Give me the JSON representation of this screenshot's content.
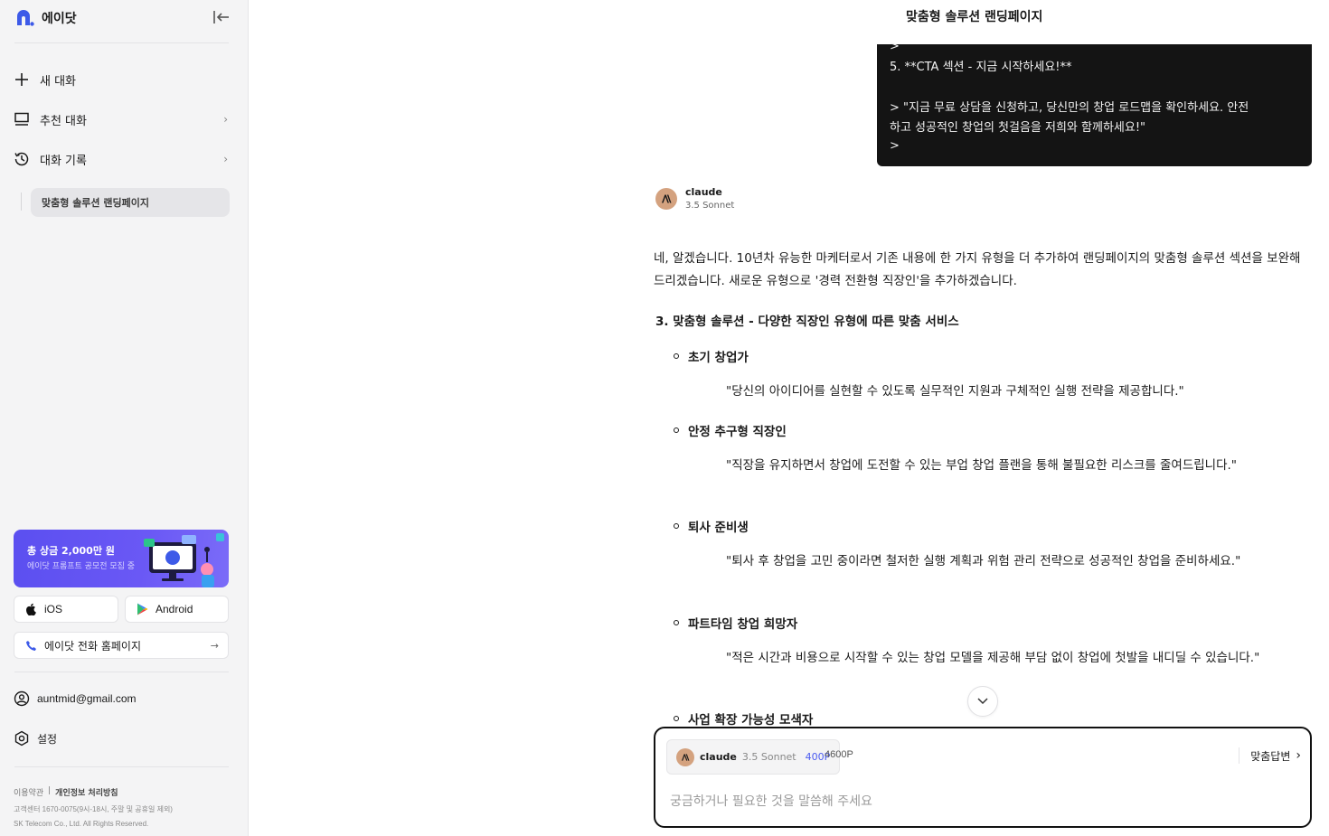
{
  "sidebar": {
    "brand": "에이닷",
    "nav": [
      {
        "label": "새 대화"
      },
      {
        "label": "추천 대화"
      },
      {
        "label": "대화 기록"
      }
    ],
    "history": [
      {
        "label": "맞춤형 솔루션 랜딩페이지"
      }
    ],
    "promo": {
      "title": "총 상금 2,000만 원",
      "subtitle": "에이닷 프롬프트 공모전 모집 중"
    },
    "apps": {
      "ios": "iOS",
      "android": "Android"
    },
    "phone_link": "에이닷 전화 홈페이지",
    "account_email": "auntmid@gmail.com",
    "settings": "설정",
    "footer": {
      "terms": "이용약관",
      "privacy": "개인정보 처리방침",
      "support": "고객센터 1670-0075(9시-18시, 주말 및 공휴일 제외)",
      "copyright": "SK Telecom Co., Ltd. All Rights Reserved."
    }
  },
  "main": {
    "title": "맞춤형 솔루션 랜딩페이지",
    "code_lines": [
      ">",
      "5. **CTA 섹션 - 지금 시작하세요!**",
      "",
      "> \"지금 무료 상담을 신청하고, 당신만의 창업 로드맵을 확인하세요. 안전",
      "하고 성공적인 창업의 첫걸음을 저희와 함께하세요!\"",
      ">"
    ],
    "model": {
      "name": "claude",
      "version": "3.5 Sonnet"
    },
    "intro": "네, 알겠습니다. 10년차 유능한 마케터로서 기존 내용에 한 가지 유형을 더 추가하여 랜딩페이지의 맞춤형 솔루션 섹션을 보완해 드리겠습니다. 새로운 유형으로 '경력 전환형 직장인'을 추가하겠습니다.",
    "section_heading": "3. 맞춤형 솔루션 - 다양한 직장인 유형에 따른 맞춤 서비스",
    "items": [
      {
        "title": "초기 창업가",
        "quote": "\"당신의 아이디어를 실현할 수 있도록 실무적인 지원과 구체적인 실행 전략을 제공합니다.\""
      },
      {
        "title": "안정 추구형 직장인",
        "quote": "\"직장을 유지하면서 창업에 도전할 수 있는 부업 창업 플랜을 통해 불필요한 리스크를 줄여드립니다.\""
      },
      {
        "title": "퇴사 준비생",
        "quote": "\"퇴사 후 창업을 고민 중이라면 철저한 실행 계획과 위험 관리 전략으로 성공적인 창업을 준비하세요.\""
      },
      {
        "title": "파트타임 창업 희망자",
        "quote": "\"적은 시간과 비용으로 시작할 수 있는 창업 모델을 제공해 부담 없이 창업에 첫발을 내디딜 수 있습니다.\""
      },
      {
        "title": "사업 확장 가능성 모색자",
        "quote": ""
      }
    ],
    "composer": {
      "model_name": "claude",
      "model_version": "3.5 Sonnet",
      "cost": "400P",
      "points": "4600P",
      "custom_answer": "맞춤답변",
      "placeholder": "궁금하거나 필요한 것을 말씀해 주세요"
    }
  },
  "colors": {
    "accent": "#5b4ff0",
    "code_bg": "#141414",
    "claude_avatar": "#d4a27f",
    "cost_blue": "#4b5cf0"
  }
}
